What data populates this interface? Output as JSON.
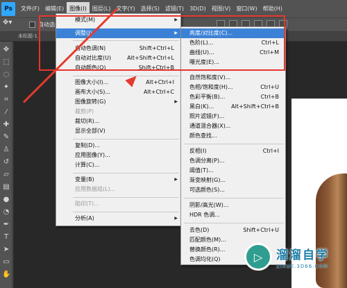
{
  "app": {
    "logo": "Ps"
  },
  "menubar": {
    "items": [
      {
        "label": "文件(F)"
      },
      {
        "label": "编辑(E)"
      },
      {
        "label": "图像(I)"
      },
      {
        "label": "图层(L)"
      },
      {
        "label": "文字(Y)"
      },
      {
        "label": "选择(S)"
      },
      {
        "label": "滤镜(T)"
      },
      {
        "label": "3D(D)"
      },
      {
        "label": "视图(V)"
      },
      {
        "label": "窗口(W)"
      },
      {
        "label": "帮助(H)"
      }
    ],
    "active_index": 2
  },
  "options_bar": {
    "tool_icon": "move-tool-icon",
    "auto_select_label": "自动选择："
  },
  "document_tab": {
    "title": "未标题-1"
  },
  "image_menu": {
    "items": [
      {
        "label": "模式(M)",
        "shortcut": "",
        "submenu": true
      },
      {
        "label": "调整(J)",
        "shortcut": "",
        "submenu": true
      },
      {
        "label": "自动色调(N)",
        "shortcut": "Shift+Ctrl+L"
      },
      {
        "label": "自动对比度(U)",
        "shortcut": "Alt+Shift+Ctrl+L"
      },
      {
        "label": "自动颜色(O)",
        "shortcut": "Shift+Ctrl+B"
      },
      {
        "label": "图像大小(I)...",
        "shortcut": "Alt+Ctrl+I"
      },
      {
        "label": "画布大小(S)...",
        "shortcut": "Alt+Ctrl+C"
      },
      {
        "label": "图像旋转(G)",
        "shortcut": "",
        "submenu": true
      },
      {
        "label": "裁剪(P)",
        "shortcut": ""
      },
      {
        "label": "裁切(R)...",
        "shortcut": ""
      },
      {
        "label": "显示全部(V)",
        "shortcut": ""
      },
      {
        "label": "复制(D)...",
        "shortcut": ""
      },
      {
        "label": "应用图像(Y)...",
        "shortcut": ""
      },
      {
        "label": "计算(C)...",
        "shortcut": ""
      },
      {
        "label": "变量(B)",
        "shortcut": "",
        "submenu": true
      },
      {
        "label": "应用数据组(L)...",
        "shortcut": ""
      },
      {
        "label": "陷印(T)...",
        "shortcut": ""
      },
      {
        "label": "分析(A)",
        "shortcut": "",
        "submenu": true
      }
    ]
  },
  "adjust_submenu": {
    "items": [
      {
        "label": "亮度/对比度(C)...",
        "shortcut": ""
      },
      {
        "label": "色阶(L)...",
        "shortcut": "Ctrl+L"
      },
      {
        "label": "曲线(U)...",
        "shortcut": "Ctrl+M"
      },
      {
        "label": "曝光度(E)...",
        "shortcut": ""
      },
      {
        "label": "自然饱和度(V)...",
        "shortcut": ""
      },
      {
        "label": "色相/饱和度(H)...",
        "shortcut": "Ctrl+U"
      },
      {
        "label": "色彩平衡(B)...",
        "shortcut": "Ctrl+B"
      },
      {
        "label": "黑白(K)...",
        "shortcut": "Alt+Shift+Ctrl+B"
      },
      {
        "label": "照片滤镜(F)...",
        "shortcut": ""
      },
      {
        "label": "通道混合器(X)...",
        "shortcut": ""
      },
      {
        "label": "颜色查找...",
        "shortcut": ""
      },
      {
        "label": "反相(I)",
        "shortcut": "Ctrl+I"
      },
      {
        "label": "色调分离(P)...",
        "shortcut": ""
      },
      {
        "label": "阈值(T)...",
        "shortcut": ""
      },
      {
        "label": "渐变映射(G)...",
        "shortcut": ""
      },
      {
        "label": "可选颜色(S)...",
        "shortcut": ""
      },
      {
        "label": "阴影/高光(W)...",
        "shortcut": ""
      },
      {
        "label": "HDR 色调...",
        "shortcut": ""
      },
      {
        "label": "去色(D)",
        "shortcut": "Shift+Ctrl+U"
      },
      {
        "label": "匹配颜色(M)...",
        "shortcut": ""
      },
      {
        "label": "替换颜色(R)...",
        "shortcut": ""
      },
      {
        "label": "色调均化(Q)",
        "shortcut": ""
      }
    ]
  },
  "watermark": {
    "title": "溜溜自学",
    "url": "ZIXUE.3D66.COM",
    "logo_glyph": "▷"
  },
  "colors": {
    "highlight": "#3b82d6",
    "annotation_red": "#e8352b",
    "menu_bg": "#f0f0f0",
    "ui_dark": "#535353"
  }
}
